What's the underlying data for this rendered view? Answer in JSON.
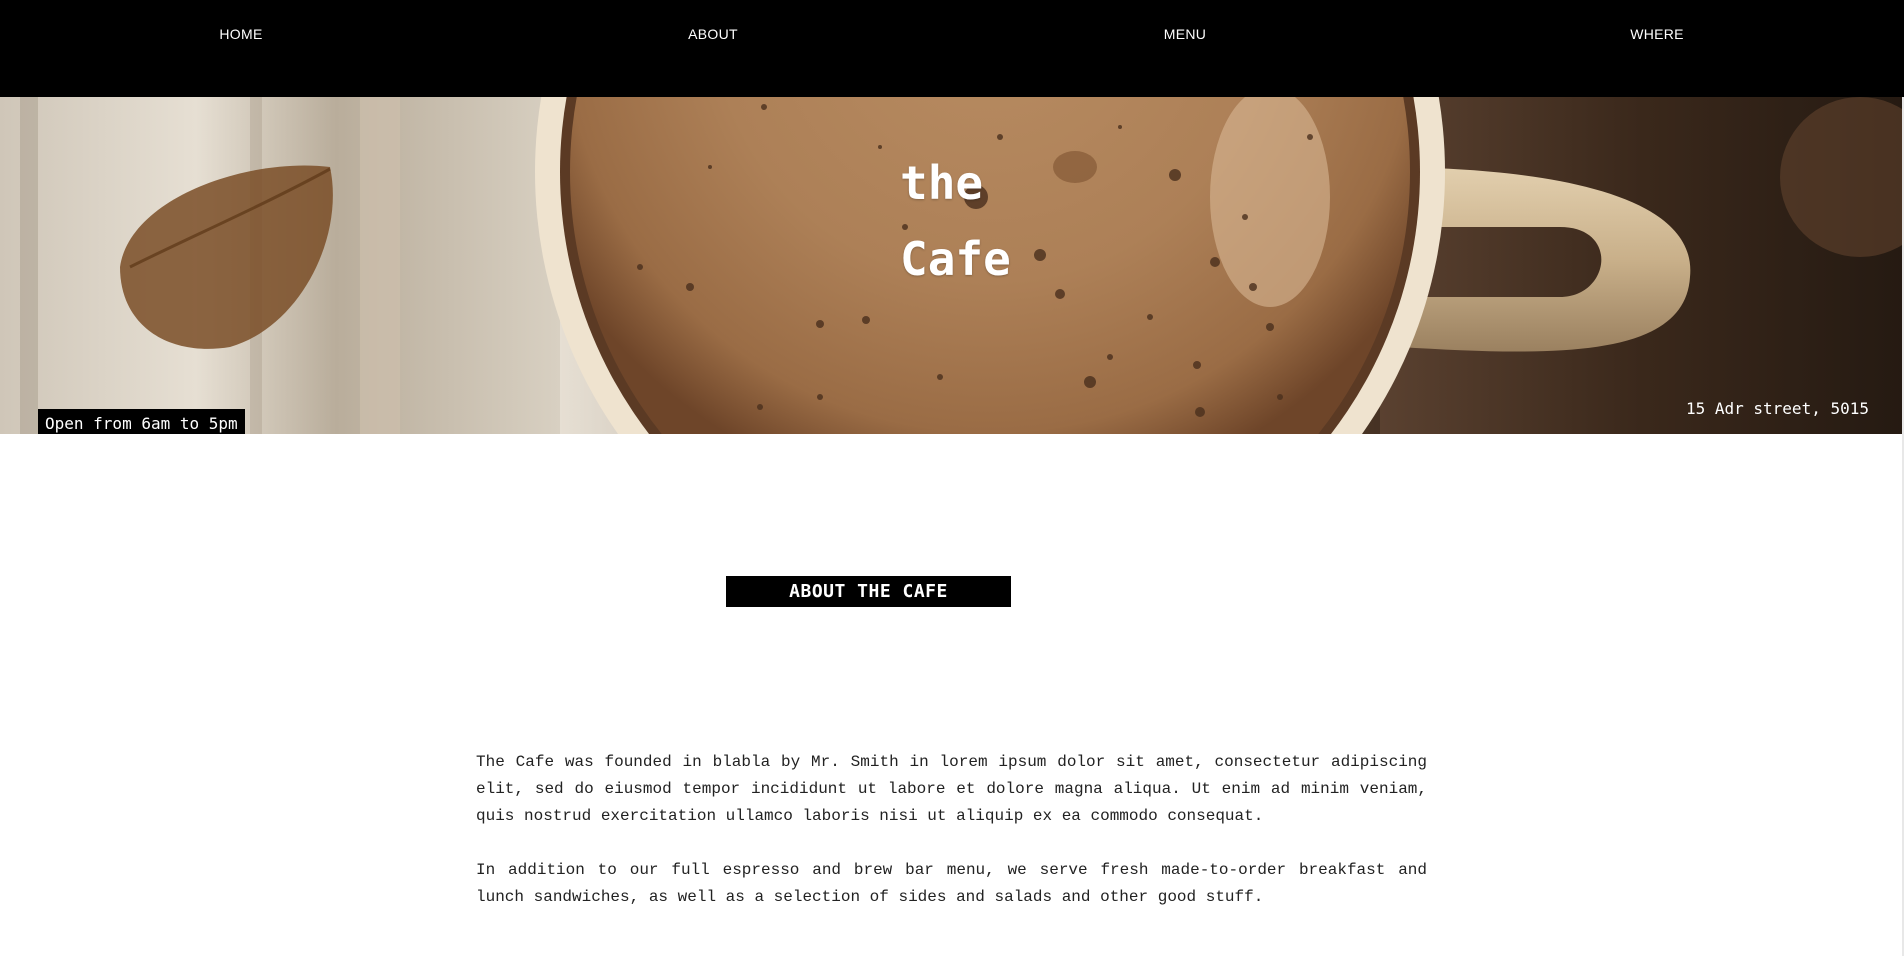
{
  "nav": {
    "items": [
      {
        "label": "HOME"
      },
      {
        "label": "ABOUT"
      },
      {
        "label": "MENU"
      },
      {
        "label": "WHERE"
      }
    ]
  },
  "hero": {
    "title_line1": "the",
    "title_line2": "Cafe",
    "hours": "Open from 6am to 5pm",
    "address": "15 Adr street, 5015"
  },
  "about": {
    "heading": "ABOUT THE CAFE",
    "paragraphs": [
      "The Cafe was founded in blabla by Mr. Smith in lorem ipsum dolor sit amet, consectetur adipiscing elit, sed do eiusmod tempor incididunt ut labore et dolore magna aliqua. Ut enim ad minim veniam, quis nostrud exercitation ullamco laboris nisi ut aliquip ex ea commodo consequat.",
      "In addition to our full espresso and brew bar menu, we serve fresh made-to-order breakfast and lunch sandwiches, as well as a selection of sides and salads and other good stuff."
    ]
  },
  "colors": {
    "nav_bg": "#000000",
    "badge_bg": "#000000",
    "text": "#222222"
  }
}
